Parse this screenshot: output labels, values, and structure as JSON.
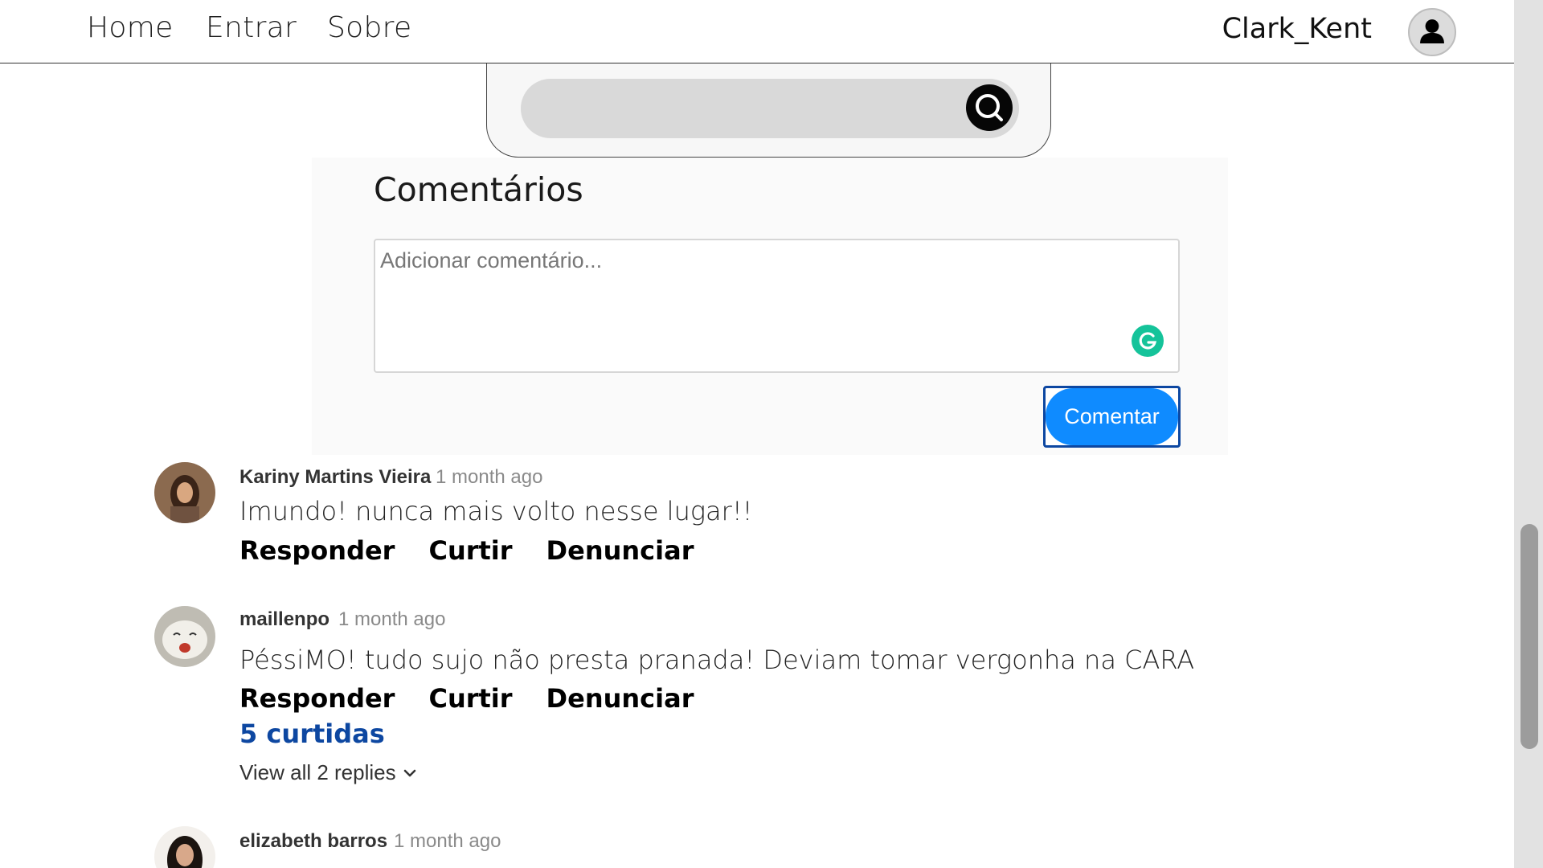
{
  "nav": {
    "links": [
      "Home",
      "Entrar",
      "Sobre"
    ],
    "username": "Clark_Kent"
  },
  "search": {
    "placeholder": ""
  },
  "comments_form": {
    "title": "Comentários",
    "placeholder": "Adicionar comentário...",
    "submit_label": "Comentar"
  },
  "comments": [
    {
      "author": "Kariny Martins Vieira",
      "time": "1 month ago",
      "text": "Imundo! nunca mais volto nesse lugar!!",
      "actions": [
        "Responder",
        "Curtir",
        "Denunciar"
      ]
    },
    {
      "author": "maillenpo",
      "time": "1 month ago",
      "text": "PéssiMO! tudo sujo não presta pranada! Deviam tomar vergonha na CARA",
      "actions": [
        "Responder",
        "Curtir",
        "Denunciar"
      ],
      "likes": "5 curtidas",
      "replies": "View all 2 replies"
    },
    {
      "author": "elizabeth barros",
      "time": "1 month ago"
    }
  ],
  "colors": {
    "accent_button": "#0f8bff",
    "likes_text": "#0d47a1",
    "grammarly": "#15c39a"
  },
  "icons": [
    "user-avatar-icon",
    "search-icon",
    "grammarly-icon",
    "chevron-down-icon"
  ]
}
